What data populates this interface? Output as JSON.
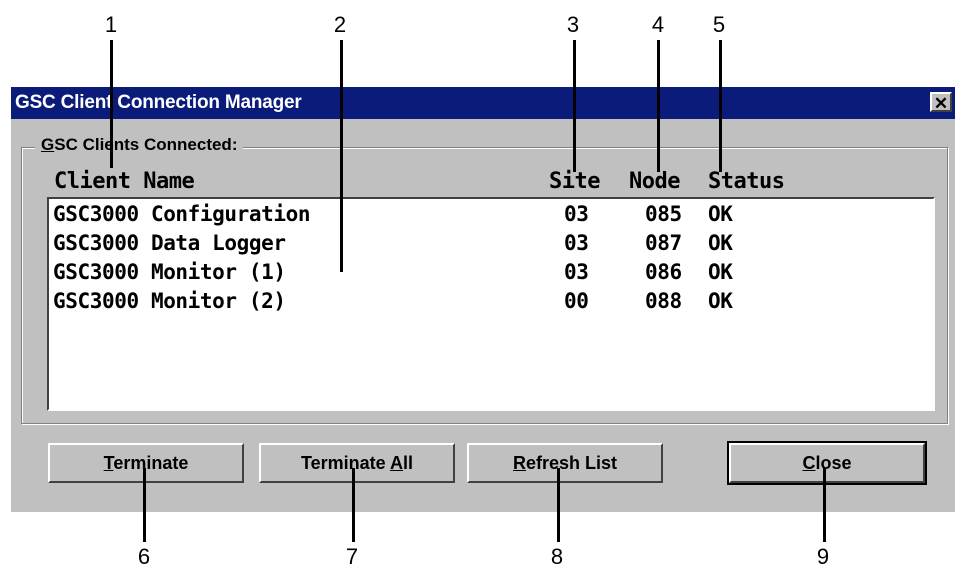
{
  "window": {
    "title": "GSC Client Connection Manager",
    "close_glyph": "✕"
  },
  "group": {
    "label_mnemonic": "G",
    "label_rest": "SC Clients Connected:"
  },
  "columns": {
    "name": "Client Name",
    "site": "Site",
    "node": "Node",
    "status": "Status"
  },
  "clients": [
    {
      "name": "GSC3000 Configuration",
      "site": "03",
      "node": "085",
      "status": "OK"
    },
    {
      "name": "GSC3000 Data Logger",
      "site": "03",
      "node": "087",
      "status": "OK"
    },
    {
      "name": "GSC3000 Monitor (1)",
      "site": "03",
      "node": "086",
      "status": "OK"
    },
    {
      "name": "GSC3000 Monitor (2)",
      "site": "00",
      "node": "088",
      "status": "OK"
    }
  ],
  "buttons": {
    "terminate": {
      "mnemonic": "T",
      "rest": "erminate"
    },
    "terminate_all": {
      "pre": "Terminate ",
      "mnemonic": "A",
      "rest": "ll"
    },
    "refresh": {
      "mnemonic": "R",
      "rest": "efresh List"
    },
    "close": {
      "mnemonic": "C",
      "rest": "lose"
    }
  },
  "callouts": [
    "1",
    "2",
    "3",
    "4",
    "5",
    "6",
    "7",
    "8",
    "9"
  ]
}
